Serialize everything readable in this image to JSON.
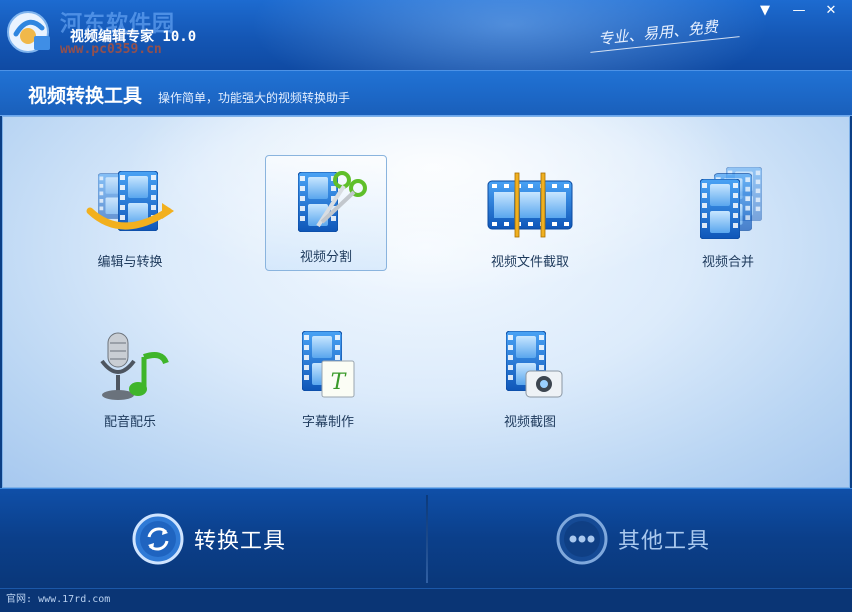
{
  "titlebar": {
    "watermark": "河东软件园",
    "watermark_url": "www.pc0359.cn",
    "app_title": "视频编辑专家 10.0",
    "slogan": "专业、易用、免费",
    "buttons": {
      "menu": "▼",
      "minimize": "—",
      "close": "✕"
    }
  },
  "header": {
    "title": "视频转换工具",
    "subtitle": "操作简单，功能强大的视频转换助手"
  },
  "tools": [
    {
      "label": "编辑与转换",
      "icon": "edit-convert-icon",
      "selected": false
    },
    {
      "label": "视频分割",
      "icon": "video-split-icon",
      "selected": true
    },
    {
      "label": "视频文件截取",
      "icon": "video-trim-icon",
      "selected": false
    },
    {
      "label": "视频合并",
      "icon": "video-merge-icon",
      "selected": false
    },
    {
      "label": "配音配乐",
      "icon": "dubbing-music-icon",
      "selected": false
    },
    {
      "label": "字幕制作",
      "icon": "subtitle-icon",
      "selected": false
    },
    {
      "label": "视频截图",
      "icon": "video-screenshot-icon",
      "selected": false
    }
  ],
  "bottom": {
    "convert_label": "转换工具",
    "other_label": "其他工具"
  },
  "footer": {
    "site_label": "官网:",
    "site_url": "www.17rd.com"
  },
  "colors": {
    "titlebar": "#1456b4",
    "header": "#1c67c6",
    "main_bg": "#dcebfb",
    "bottom_bg": "#0b3f8a",
    "film_blue": "#1a6fd6",
    "label_text": "#1e3a5c"
  }
}
